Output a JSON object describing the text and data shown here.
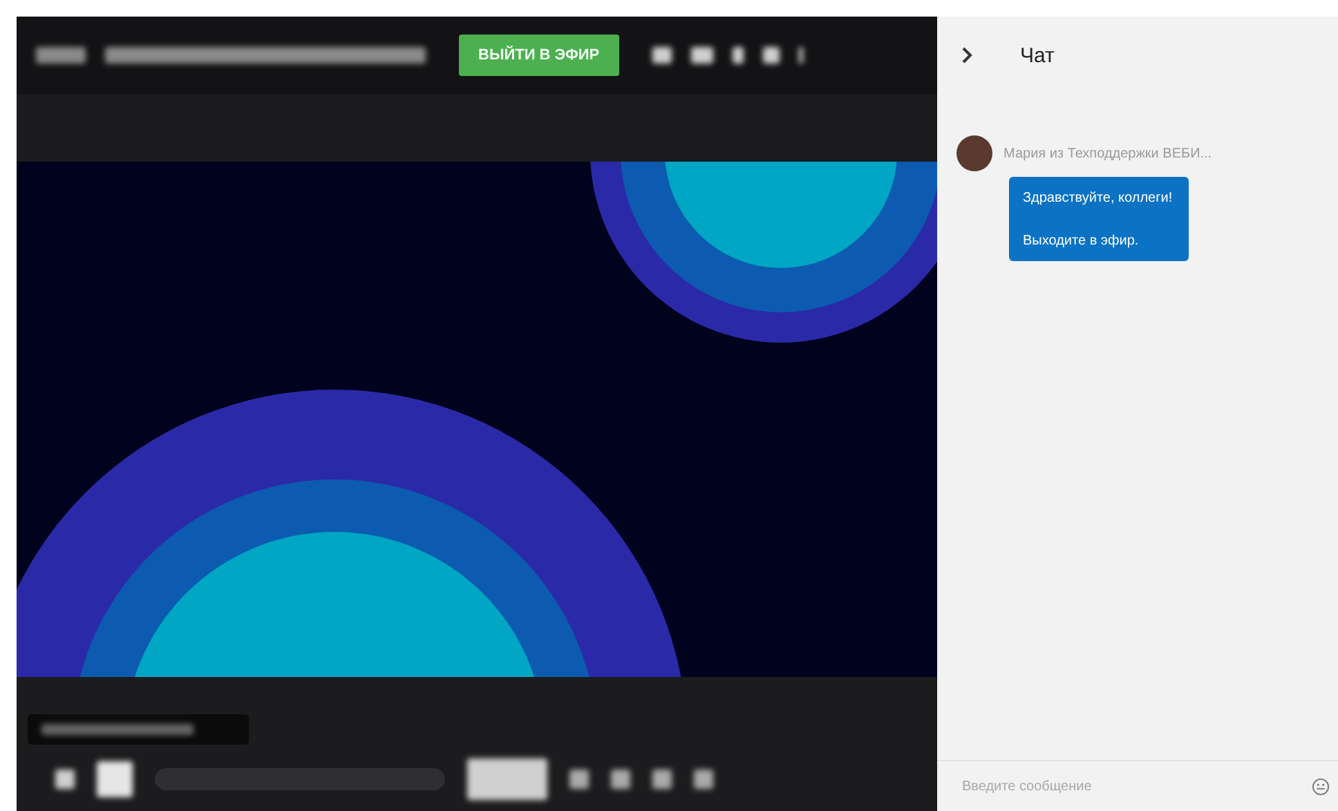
{
  "top_bar": {
    "live_button": "ВЫЙТИ В ЭФИР"
  },
  "chat": {
    "title": "Чат",
    "messages": [
      {
        "sender": "Мария из Техподдержки ВЕБИ...",
        "lines": [
          "Здравствуйте, коллеги!",
          "Выходите в эфир."
        ]
      }
    ],
    "input": {
      "placeholder": "Введите сообщение"
    }
  }
}
